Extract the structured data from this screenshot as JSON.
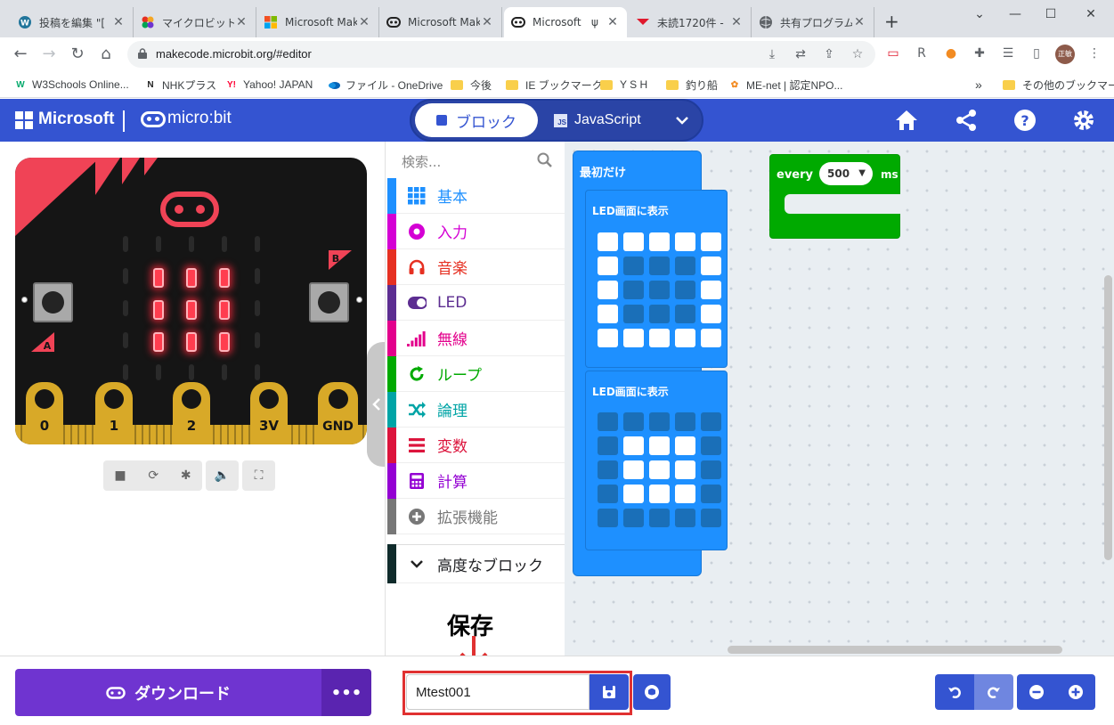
{
  "browser": {
    "tabs": [
      {
        "title": "投稿を編集 \"[",
        "icon": "wordpress-icon"
      },
      {
        "title": "マイクロビット (m",
        "icon": "microbit-foundation-icon"
      },
      {
        "title": "Microsoft Mak",
        "icon": "microsoft-icon"
      },
      {
        "title": "Microsoft Mak",
        "icon": "makecode-icon"
      },
      {
        "title": "Microsoft",
        "icon": "makecode-icon",
        "active": true
      },
      {
        "title": "未読1720件 -",
        "icon": "mail-icon"
      },
      {
        "title": "共有プログラム(",
        "icon": "globe-icon"
      }
    ],
    "url": "makecode.microbit.org/#editor",
    "avatar_text": "正敏",
    "bookmarks": [
      {
        "label": "W3Schools Online...",
        "icon": "w3schools-icon"
      },
      {
        "label": "NHKプラス",
        "icon": "nhk-icon"
      },
      {
        "label": "Yahoo! JAPAN",
        "icon": "yahoo-icon"
      },
      {
        "label": "ファイル - OneDrive",
        "icon": "onedrive-icon"
      },
      {
        "label": "今後",
        "icon": "folder-icon"
      },
      {
        "label": "IE ブックマーク",
        "icon": "folder-icon"
      },
      {
        "label": "Y S H",
        "icon": "folder-icon"
      },
      {
        "label": "釣り船",
        "icon": "folder-icon"
      },
      {
        "label": "ME-net | 認定NPO...",
        "icon": "menet-icon"
      }
    ],
    "bookmarks_more": "»",
    "other_bookmarks": "その他のブックマーク"
  },
  "header": {
    "brand": "Microsoft",
    "product": "micro:bit",
    "blocks_label": "ブロック",
    "js_label": "JavaScript"
  },
  "simulator": {
    "pins": [
      "0",
      "1",
      "2",
      "3V",
      "GND"
    ],
    "button_a": "A",
    "button_b": "B",
    "leds": [
      [
        0,
        0,
        0,
        0,
        0
      ],
      [
        0,
        1,
        1,
        1,
        0
      ],
      [
        0,
        1,
        1,
        1,
        0
      ],
      [
        0,
        1,
        1,
        1,
        0
      ],
      [
        0,
        0,
        0,
        0,
        0
      ]
    ]
  },
  "toolbox": {
    "search_placeholder": "検索...",
    "categories": [
      {
        "label": "基本",
        "color": "#1e90ff",
        "icon": "grid-icon"
      },
      {
        "label": "入力",
        "color": "#d400d4",
        "icon": "input-icon"
      },
      {
        "label": "音楽",
        "color": "#e63022",
        "icon": "headphones-icon"
      },
      {
        "label": "LED",
        "color": "#5c2d91",
        "icon": "toggle-icon"
      },
      {
        "label": "無線",
        "color": "#e3008c",
        "icon": "signal-icon"
      },
      {
        "label": "ループ",
        "color": "#00aa00",
        "icon": "loop-icon"
      },
      {
        "label": "論理",
        "color": "#00a4a6",
        "icon": "shuffle-icon"
      },
      {
        "label": "変数",
        "color": "#dc143c",
        "icon": "list-icon"
      },
      {
        "label": "計算",
        "color": "#9400d3",
        "icon": "calculator-icon"
      },
      {
        "label": "拡張機能",
        "color": "#777777",
        "icon": "plus-icon"
      }
    ],
    "advanced_label": "高度なブロック"
  },
  "workspace": {
    "on_start_label": "最初だけ",
    "show_leds_label": "LED画面に表示",
    "leds_1": [
      [
        1,
        1,
        1,
        1,
        1
      ],
      [
        1,
        0,
        0,
        0,
        1
      ],
      [
        1,
        0,
        0,
        0,
        1
      ],
      [
        1,
        0,
        0,
        0,
        1
      ],
      [
        1,
        1,
        1,
        1,
        1
      ]
    ],
    "leds_2": [
      [
        0,
        0,
        0,
        0,
        0
      ],
      [
        0,
        1,
        1,
        1,
        0
      ],
      [
        0,
        1,
        1,
        1,
        0
      ],
      [
        0,
        1,
        1,
        1,
        0
      ],
      [
        0,
        0,
        0,
        0,
        0
      ]
    ],
    "every_label": "every",
    "every_value": "500",
    "every_unit": "ms",
    "colors": {
      "basic": "#1e90ff",
      "loops": "#00aa00"
    }
  },
  "bottom": {
    "download_label": "ダウンロード",
    "more_label": "•••",
    "project_name": "Mtest001"
  },
  "annotation": {
    "label": "保存",
    "color": "#e03131"
  }
}
